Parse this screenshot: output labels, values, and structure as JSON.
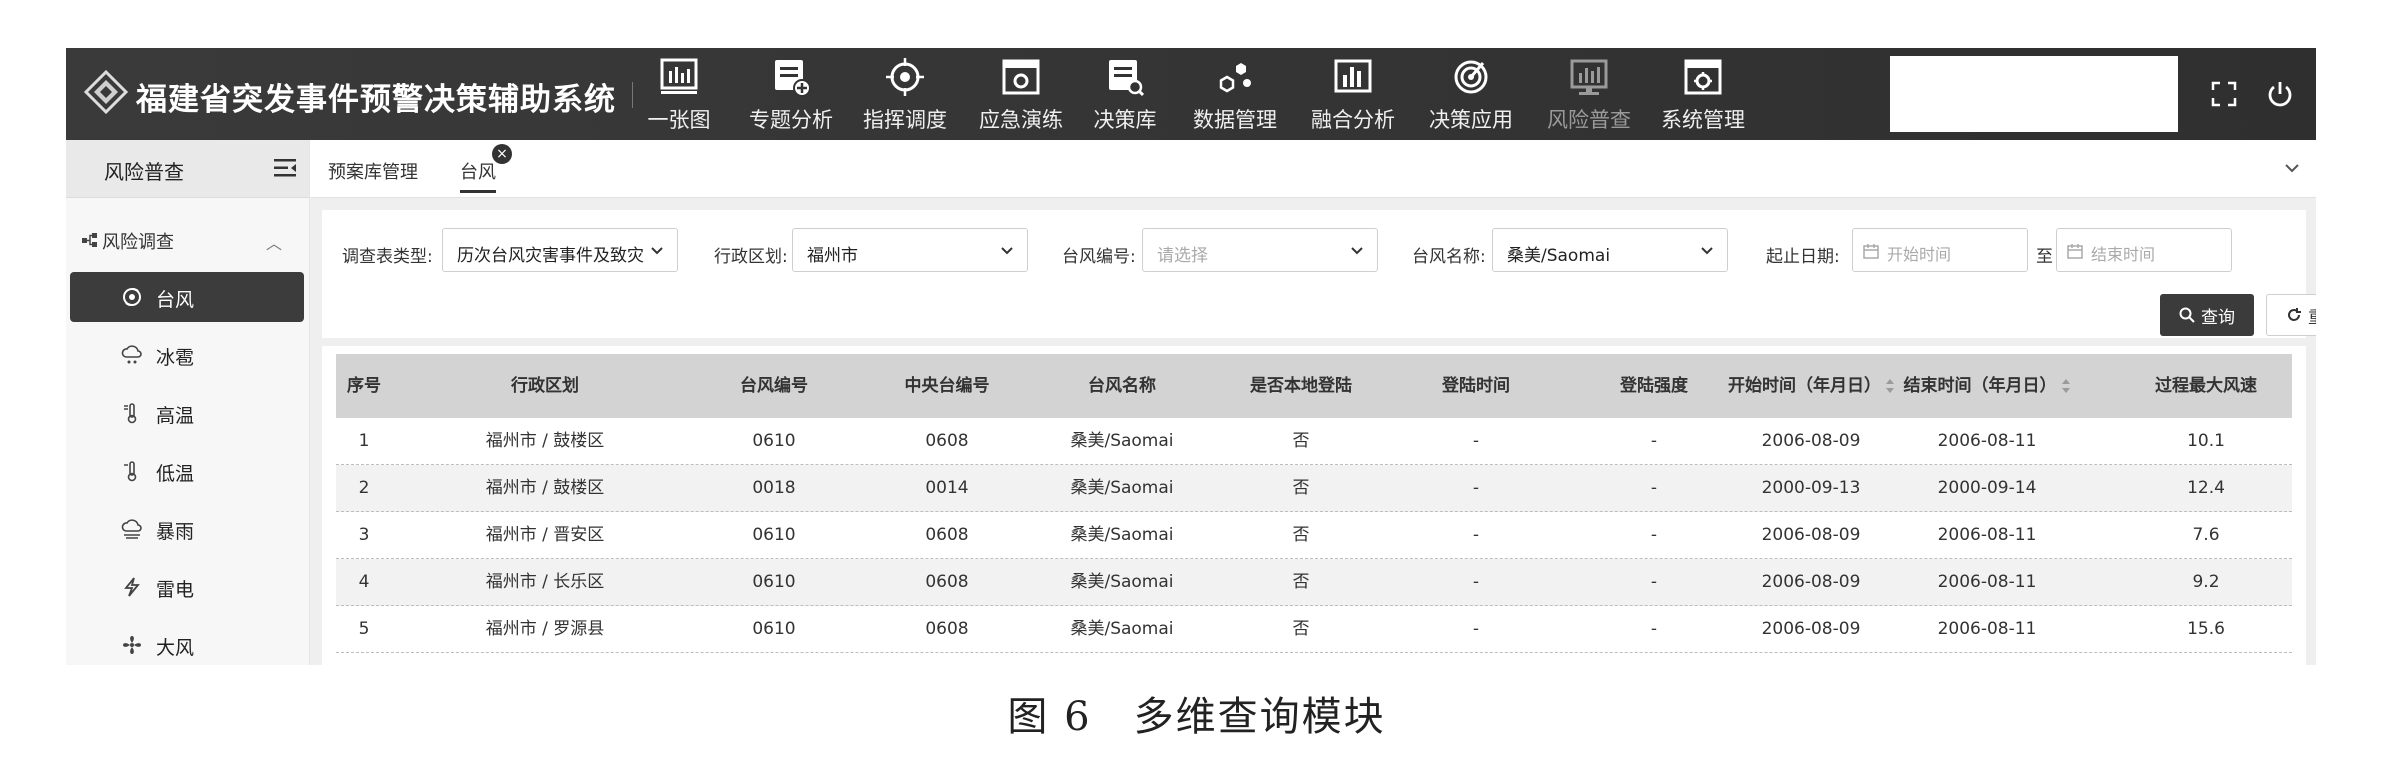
{
  "app": {
    "title": "福建省突发事件预警决策辅助系统"
  },
  "nav": [
    {
      "label": "一张图",
      "icon": "map-screen-icon"
    },
    {
      "label": "专题分析",
      "icon": "document-add-icon"
    },
    {
      "label": "指挥调度",
      "icon": "target-icon"
    },
    {
      "label": "应急演练",
      "icon": "drill-window-icon"
    },
    {
      "label": "决策库",
      "icon": "document-search-icon"
    },
    {
      "label": "数据管理",
      "icon": "hexagon-nodes-icon"
    },
    {
      "label": "融合分析",
      "icon": "bar-chart-icon"
    },
    {
      "label": "决策应用",
      "icon": "radar-icon"
    },
    {
      "label": "风险普查",
      "icon": "monitor-chart-icon",
      "active": true
    },
    {
      "label": "系统管理",
      "icon": "settings-window-icon"
    }
  ],
  "sidebar": {
    "title": "风险普查",
    "group": "风险调查",
    "items": [
      {
        "label": "台风",
        "icon": "typhoon-icon",
        "active": true
      },
      {
        "label": "冰雹",
        "icon": "hail-icon"
      },
      {
        "label": "高温",
        "icon": "thermometer-high-icon"
      },
      {
        "label": "低温",
        "icon": "thermometer-low-icon"
      },
      {
        "label": "暴雨",
        "icon": "rain-cloud-icon"
      },
      {
        "label": "雷电",
        "icon": "lightning-icon"
      },
      {
        "label": "大风",
        "icon": "wind-fan-icon"
      }
    ]
  },
  "tabs": [
    {
      "label": "预案库管理"
    },
    {
      "label": "台风",
      "active": true,
      "close": "×"
    }
  ],
  "filters": {
    "survey_type_label": "调查表类型:",
    "survey_type_value": "历次台风灾害事件及致灾",
    "region_label": "行政区划:",
    "region_value": "福州市",
    "typhoon_no_label": "台风编号:",
    "typhoon_no_placeholder": "请选择",
    "typhoon_name_label": "台风名称:",
    "typhoon_name_value": "桑美/Saomai",
    "date_label": "起止日期:",
    "start_placeholder": "开始时间",
    "date_sep": "至",
    "end_placeholder": "结束时间",
    "query_label": "查询",
    "reset_label": "重置"
  },
  "table": {
    "headers": [
      "序号",
      "行政区划",
      "台风编号",
      "中央台编号",
      "台风名称",
      "是否本地登陆",
      "登陆时间",
      "登陆强度",
      "开始时间（年月日）",
      "结束时间（年月日）",
      "过程最大风速"
    ],
    "rows": [
      [
        "1",
        "福州市 / 鼓楼区",
        "0610",
        "0608",
        "桑美/Saomai",
        "否",
        "-",
        "-",
        "2006-08-09",
        "2006-08-11",
        "10.1"
      ],
      [
        "2",
        "福州市 / 鼓楼区",
        "0018",
        "0014",
        "桑美/Saomai",
        "否",
        "-",
        "-",
        "2000-09-13",
        "2000-09-14",
        "12.4"
      ],
      [
        "3",
        "福州市 / 晋安区",
        "0610",
        "0608",
        "桑美/Saomai",
        "否",
        "-",
        "-",
        "2006-08-09",
        "2006-08-11",
        "7.6"
      ],
      [
        "4",
        "福州市 / 长乐区",
        "0610",
        "0608",
        "桑美/Saomai",
        "否",
        "-",
        "-",
        "2006-08-09",
        "2006-08-11",
        "9.2"
      ],
      [
        "5",
        "福州市 / 罗源县",
        "0610",
        "0608",
        "桑美/Saomai",
        "否",
        "-",
        "-",
        "2006-08-09",
        "2006-08-11",
        "15.6"
      ]
    ]
  },
  "caption": "图 6　多维查询模块"
}
